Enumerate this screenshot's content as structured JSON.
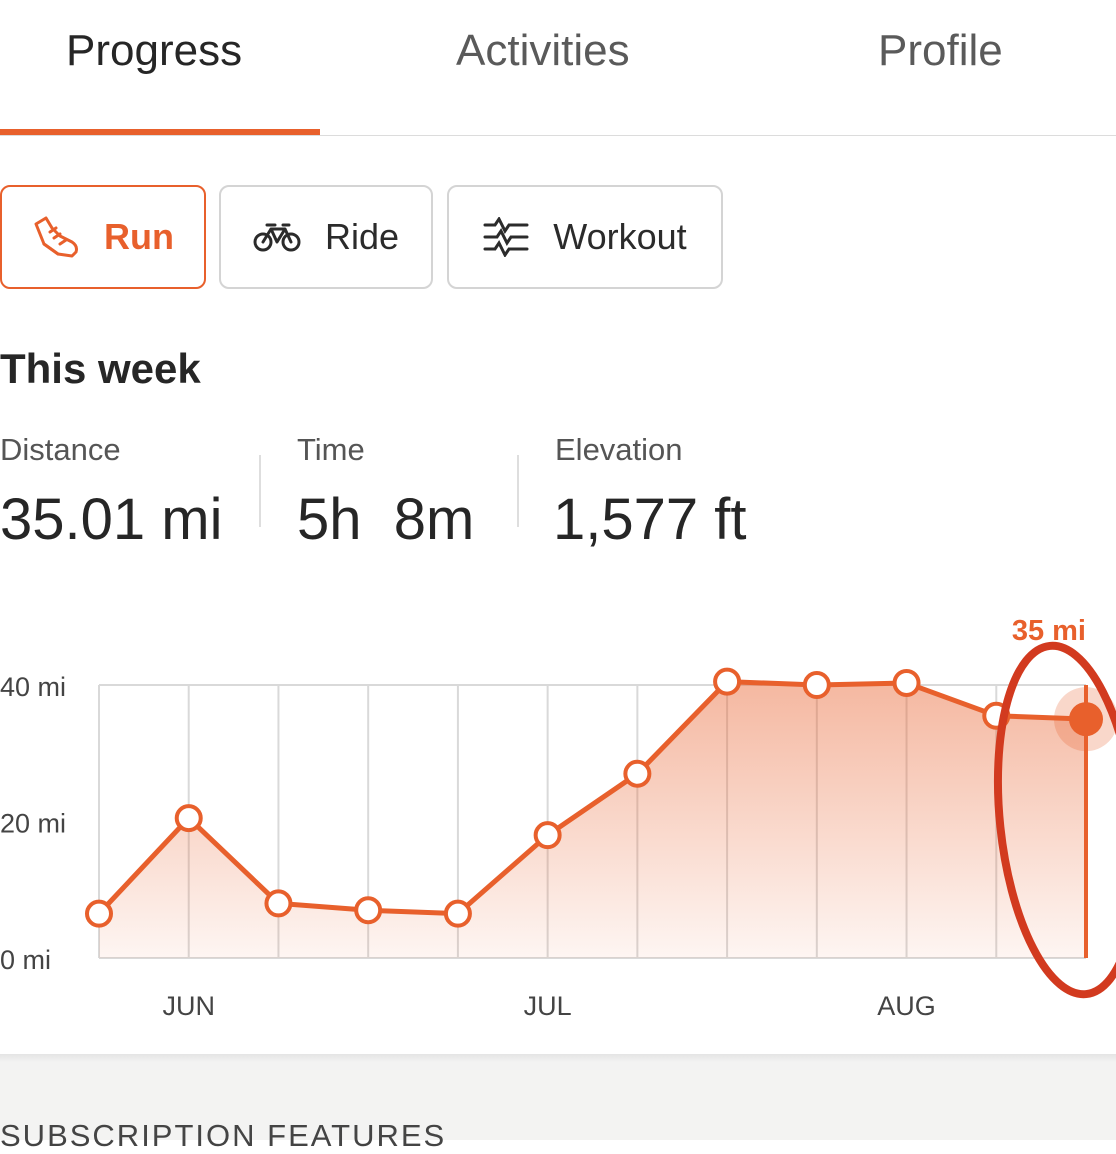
{
  "tabs": [
    {
      "label": "Progress",
      "active": true
    },
    {
      "label": "Activities",
      "active": false
    },
    {
      "label": "Profile",
      "active": false
    }
  ],
  "sport_filters": [
    {
      "label": "Run",
      "icon": "shoe-icon",
      "active": true
    },
    {
      "label": "Ride",
      "icon": "bike-icon",
      "active": false
    },
    {
      "label": "Workout",
      "icon": "workout-wave-icon",
      "active": false
    }
  ],
  "summary": {
    "title": "This week",
    "stats": [
      {
        "label": "Distance",
        "value": "35.01 mi"
      },
      {
        "label": "Time",
        "value": "5h  8m"
      },
      {
        "label": "Elevation",
        "value": "1,577 ft"
      }
    ]
  },
  "chart_data": {
    "type": "area",
    "y_ticks": [
      "40 mi",
      "20 mi",
      "0 mi"
    ],
    "ylim": [
      0,
      40
    ],
    "x_tick_labels": [
      {
        "label": "JUN",
        "index": 1
      },
      {
        "label": "JUL",
        "index": 5
      },
      {
        "label": "AUG",
        "index": 9
      }
    ],
    "values": [
      6.5,
      20.5,
      8,
      7,
      6.5,
      18,
      27,
      40.5,
      40,
      40.3,
      35.5,
      35
    ],
    "selected_index": 11,
    "selected_label": "35 mi",
    "grid": true
  },
  "annotation": {
    "type": "hand-drawn arrow and circle highlighting latest week"
  },
  "colors": {
    "accent": "#e8602c",
    "annotation": "#d23a1f",
    "grid": "#d9d9d9"
  },
  "footer": {
    "section_label": "SUBSCRIPTION FEATURES"
  }
}
